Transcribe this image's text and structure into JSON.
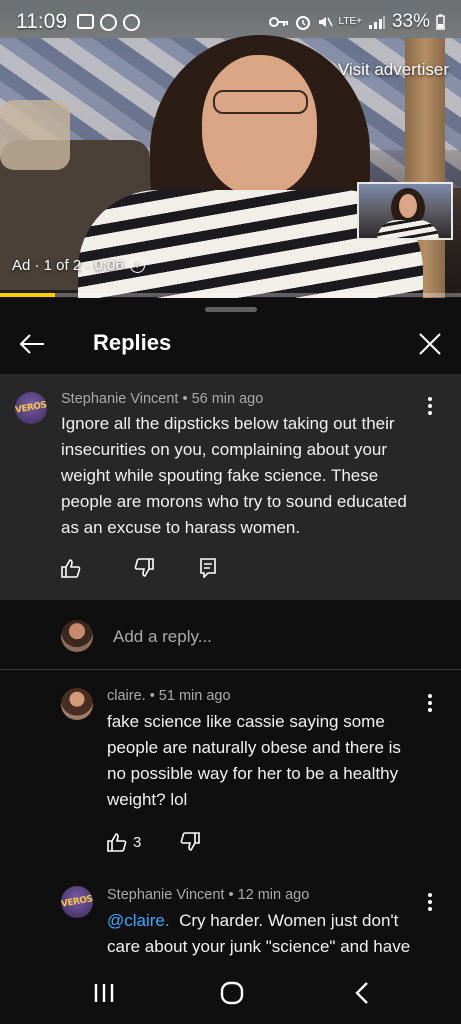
{
  "status_bar": {
    "time": "11:09",
    "network": "LTE+",
    "battery": "33%"
  },
  "video": {
    "visit_advertiser": "Visit advertiser",
    "ad_info": "Ad · 1 of 2 · 0:06",
    "ad_progress": 0.12,
    "progress_color": "#ffcc00"
  },
  "header": {
    "title": "Replies"
  },
  "top_comment": {
    "author": "Stephanie Vincent",
    "time": "56 min ago",
    "meta": "Stephanie Vincent • 56 min ago",
    "text": "Ignore all the dipsticks below taking out their insecurities on you, complaining about your weight while spouting fake science. These people are morons who try to sound educated as an excuse to harass women.",
    "avatar_text": "VEROS"
  },
  "add_reply": {
    "placeholder": "Add a reply..."
  },
  "replies": [
    {
      "meta": "claire. • 51 min ago",
      "text": "fake science like cassie saying some people are naturally obese and there is no possible way for her to be a healthy weight? lol",
      "likes": "3"
    },
    {
      "meta": "Stephanie Vincent • 12 min ago",
      "mention": "@claire.",
      "text": "Cry harder. Women just don't care about your junk \"science\" and have",
      "avatar_text": "VEROS"
    }
  ],
  "colors": {
    "background": "#0f0f0f",
    "highlight_comment_bg": "#272727",
    "mention": "#3ea6ff"
  }
}
